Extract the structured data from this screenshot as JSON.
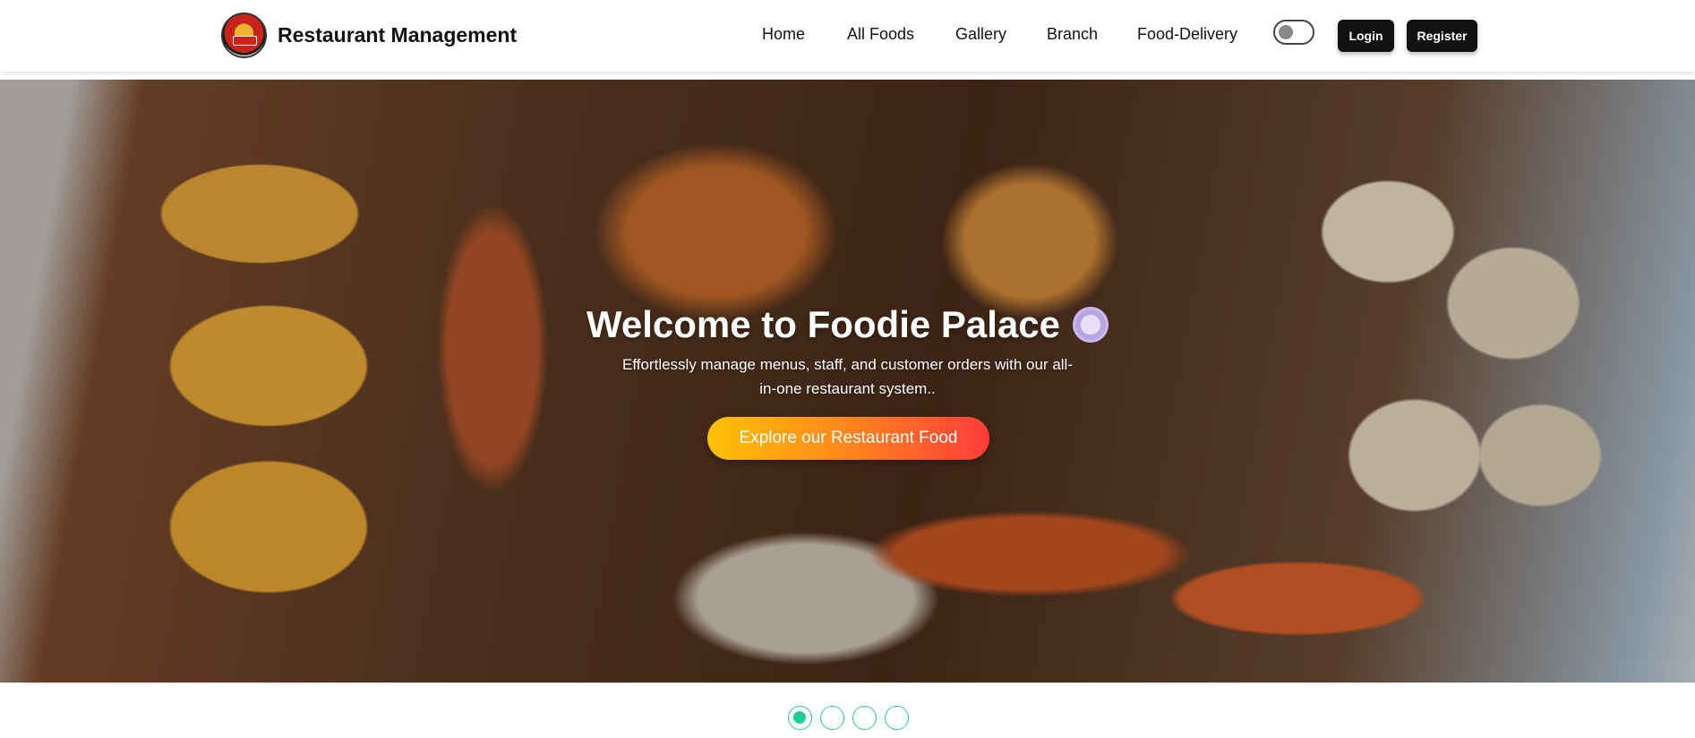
{
  "brand": {
    "name": "Restaurant Management",
    "logo_icon": "restaurant-logo-icon"
  },
  "nav": {
    "links": [
      "Home",
      "All Foods",
      "Gallery",
      "Branch",
      "Food-Delivery"
    ],
    "login_label": "Login",
    "register_label": "Register",
    "theme_toggle": "off"
  },
  "hero": {
    "title": "Welcome to Foodie Palace",
    "title_icon": "plate-cutlery-icon",
    "subtitle": "Effortlessly manage menus, staff, and customer orders with our all-in-one restaurant system..",
    "cta_label": "Explore our Restaurant Food"
  },
  "carousel": {
    "slides": 4,
    "active_index": 0
  },
  "colors": {
    "accent_green": "#1fce8e",
    "cta_gradient_start": "#ffc107",
    "cta_gradient_end": "#ff3b3b",
    "button_dark": "#111111"
  }
}
